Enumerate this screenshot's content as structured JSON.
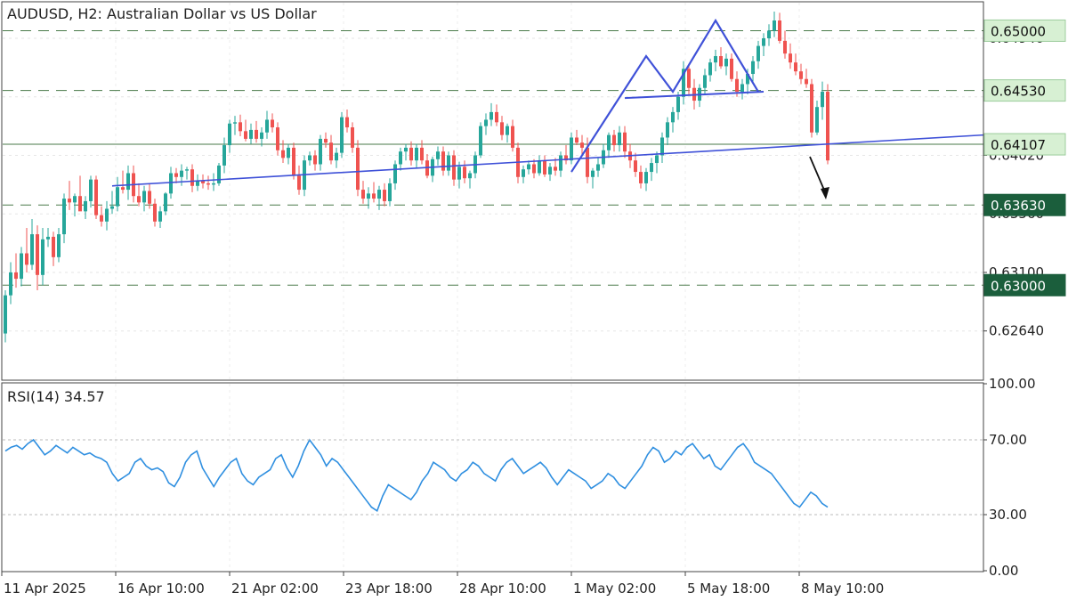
{
  "header": {
    "title": "AUDUSD, H2:  Australian Dollar vs US Dollar",
    "rsi_title": "RSI(14) 34.57"
  },
  "colors": {
    "bull": "#26a69a",
    "bear": "#ef5350",
    "trendline": "#3f51d8",
    "rsi": "#2f8fe0",
    "level_line": "#4a7a4a",
    "tag_light": "#d7f0d3",
    "tag_dark": "#1b5e3c"
  },
  "chart_data": [
    {
      "type": "candlestick",
      "title": "AUDUSD, H2:  Australian Dollar vs US Dollar",
      "ylim": [
        0.6226,
        0.6522
      ],
      "y_ticks": [
        "0.64940",
        "0.64480",
        "0.64020",
        "0.63560",
        "0.63100",
        "0.62640"
      ],
      "x_ticks": [
        "11 Apr 2025",
        "16 Apr 10:00",
        "21 Apr 02:00",
        "23 Apr 18:00",
        "28 Apr 10:00",
        "1 May 02:00",
        "5 May 18:00",
        "8 May 10:00"
      ],
      "levels": [
        {
          "value": 0.65,
          "label": "0.65000",
          "style": "dashed",
          "tag": "light"
        },
        {
          "value": 0.6453,
          "label": "0.64530",
          "style": "dashed",
          "tag": "light"
        },
        {
          "value": 0.64107,
          "label": "0.64107",
          "style": "solid",
          "tag": "light"
        },
        {
          "value": 0.6363,
          "label": "0.63630",
          "style": "dashed",
          "tag": "dark"
        },
        {
          "value": 0.63,
          "label": "0.63000",
          "style": "dashed",
          "tag": "dark"
        }
      ],
      "annotations": [
        {
          "type": "trendline",
          "description": "rising support line",
          "from": {
            "bar": 20,
            "price": 0.6378
          },
          "to": {
            "bar": 175,
            "price": 0.6416
          }
        },
        {
          "type": "neckline",
          "from": {
            "bar": 116,
            "price": 0.6447
          },
          "to": {
            "bar": 142,
            "price": 0.6452
          }
        },
        {
          "type": "pattern",
          "points": [
            {
              "bar": 106,
              "price": 0.6389
            },
            {
              "bar": 120,
              "price": 0.648
            },
            {
              "bar": 125,
              "price": 0.6452
            },
            {
              "bar": 133,
              "price": 0.6508
            },
            {
              "bar": 141,
              "price": 0.6452
            }
          ]
        },
        {
          "type": "arrow",
          "direction": "down"
        }
      ],
      "candles": [
        [
          0.6262,
          0.6296,
          0.6255,
          0.6292
        ],
        [
          0.6292,
          0.6318,
          0.6285,
          0.631
        ],
        [
          0.631,
          0.6325,
          0.6298,
          0.6305
        ],
        [
          0.6305,
          0.633,
          0.6299,
          0.6325
        ],
        [
          0.6325,
          0.6345,
          0.631,
          0.6316
        ],
        [
          0.6316,
          0.6352,
          0.6312,
          0.634
        ],
        [
          0.634,
          0.6347,
          0.6296,
          0.6308
        ],
        [
          0.6308,
          0.6345,
          0.63,
          0.6336
        ],
        [
          0.6336,
          0.6345,
          0.633,
          0.6338
        ],
        [
          0.6338,
          0.6342,
          0.6315,
          0.6322
        ],
        [
          0.6322,
          0.6345,
          0.6318,
          0.634
        ],
        [
          0.634,
          0.6372,
          0.6333,
          0.6368
        ],
        [
          0.6368,
          0.6382,
          0.6359,
          0.6365
        ],
        [
          0.6365,
          0.6372,
          0.6354,
          0.637
        ],
        [
          0.637,
          0.6386,
          0.6362,
          0.6358
        ],
        [
          0.6358,
          0.637,
          0.6352,
          0.6366
        ],
        [
          0.6366,
          0.6386,
          0.6361,
          0.6383
        ],
        [
          0.6383,
          0.6386,
          0.6352,
          0.6355
        ],
        [
          0.6355,
          0.6362,
          0.6346,
          0.635
        ],
        [
          0.635,
          0.6366,
          0.6343,
          0.636
        ],
        [
          0.636,
          0.6374,
          0.6356,
          0.6362
        ],
        [
          0.6362,
          0.6385,
          0.6358,
          0.6377
        ],
        [
          0.6377,
          0.639,
          0.6372,
          0.6375
        ],
        [
          0.6375,
          0.6394,
          0.6367,
          0.6388
        ],
        [
          0.6388,
          0.6394,
          0.6365,
          0.637
        ],
        [
          0.637,
          0.638,
          0.6362,
          0.6365
        ],
        [
          0.6365,
          0.6378,
          0.6358,
          0.6374
        ],
        [
          0.6374,
          0.638,
          0.636,
          0.6364
        ],
        [
          0.6364,
          0.6368,
          0.6346,
          0.635
        ],
        [
          0.635,
          0.6362,
          0.6345,
          0.6358
        ],
        [
          0.6358,
          0.6373,
          0.6355,
          0.6372
        ],
        [
          0.6372,
          0.6393,
          0.6368,
          0.6388
        ],
        [
          0.6388,
          0.6392,
          0.638,
          0.6385
        ],
        [
          0.6385,
          0.6395,
          0.6378,
          0.639
        ],
        [
          0.639,
          0.6393,
          0.6383,
          0.6391
        ],
        [
          0.6391,
          0.6395,
          0.6373,
          0.6378
        ],
        [
          0.6378,
          0.6387,
          0.6374,
          0.6382
        ],
        [
          0.6382,
          0.6387,
          0.6376,
          0.638
        ],
        [
          0.638,
          0.6386,
          0.6375,
          0.6379
        ],
        [
          0.6379,
          0.6388,
          0.6374,
          0.638
        ],
        [
          0.638,
          0.6396,
          0.6378,
          0.6394
        ],
        [
          0.6394,
          0.6416,
          0.6388,
          0.641
        ],
        [
          0.641,
          0.643,
          0.6404,
          0.6427
        ],
        [
          0.6427,
          0.6433,
          0.6418,
          0.6428
        ],
        [
          0.6428,
          0.6434,
          0.6417,
          0.6421
        ],
        [
          0.6421,
          0.643,
          0.6413,
          0.6415
        ],
        [
          0.6415,
          0.6427,
          0.6411,
          0.6422
        ],
        [
          0.6422,
          0.6429,
          0.6412,
          0.6415
        ],
        [
          0.6415,
          0.6424,
          0.6409,
          0.642
        ],
        [
          0.642,
          0.6437,
          0.6415,
          0.643
        ],
        [
          0.643,
          0.6435,
          0.642,
          0.6424
        ],
        [
          0.6424,
          0.6428,
          0.6402,
          0.6406
        ],
        [
          0.6406,
          0.6414,
          0.6396,
          0.64
        ],
        [
          0.64,
          0.6411,
          0.6395,
          0.6408
        ],
        [
          0.6408,
          0.6412,
          0.6383,
          0.6386
        ],
        [
          0.6386,
          0.6394,
          0.6371,
          0.6375
        ],
        [
          0.6375,
          0.6402,
          0.637,
          0.6398
        ],
        [
          0.6398,
          0.6405,
          0.6394,
          0.6402
        ],
        [
          0.6402,
          0.6406,
          0.639,
          0.6395
        ],
        [
          0.6395,
          0.6418,
          0.639,
          0.6415
        ],
        [
          0.6415,
          0.642,
          0.6408,
          0.6412
        ],
        [
          0.6412,
          0.6418,
          0.6395,
          0.6398
        ],
        [
          0.6398,
          0.6408,
          0.6392,
          0.6404
        ],
        [
          0.6404,
          0.6436,
          0.64,
          0.6432
        ],
        [
          0.6432,
          0.6438,
          0.642,
          0.6424
        ],
        [
          0.6424,
          0.6428,
          0.6404,
          0.6408
        ],
        [
          0.6408,
          0.6414,
          0.637,
          0.6375
        ],
        [
          0.6375,
          0.6382,
          0.6364,
          0.6368
        ],
        [
          0.6368,
          0.6377,
          0.636,
          0.6372
        ],
        [
          0.6372,
          0.6381,
          0.6365,
          0.6368
        ],
        [
          0.6368,
          0.6378,
          0.6359,
          0.6375
        ],
        [
          0.6375,
          0.638,
          0.6362,
          0.6366
        ],
        [
          0.6366,
          0.6384,
          0.6362,
          0.638
        ],
        [
          0.638,
          0.6398,
          0.6375,
          0.6395
        ],
        [
          0.6395,
          0.6408,
          0.639,
          0.6405
        ],
        [
          0.6405,
          0.6411,
          0.6398,
          0.6408
        ],
        [
          0.6408,
          0.6413,
          0.6394,
          0.6398
        ],
        [
          0.6398,
          0.6411,
          0.6392,
          0.6408
        ],
        [
          0.6408,
          0.6414,
          0.6395,
          0.6398
        ],
        [
          0.6398,
          0.6403,
          0.6384,
          0.6386
        ],
        [
          0.6386,
          0.6401,
          0.6381,
          0.6399
        ],
        [
          0.6399,
          0.6409,
          0.6394,
          0.6405
        ],
        [
          0.6405,
          0.6409,
          0.6386,
          0.639
        ],
        [
          0.639,
          0.6405,
          0.6386,
          0.6402
        ],
        [
          0.6402,
          0.6406,
          0.6378,
          0.6383
        ],
        [
          0.6383,
          0.6397,
          0.6376,
          0.6393
        ],
        [
          0.6393,
          0.6398,
          0.638,
          0.6384
        ],
        [
          0.6384,
          0.639,
          0.6376,
          0.6388
        ],
        [
          0.6388,
          0.6405,
          0.6384,
          0.6402
        ],
        [
          0.6402,
          0.6428,
          0.64,
          0.6425
        ],
        [
          0.6425,
          0.6435,
          0.6418,
          0.643
        ],
        [
          0.643,
          0.6443,
          0.6425,
          0.6436
        ],
        [
          0.6436,
          0.6442,
          0.6425,
          0.6428
        ],
        [
          0.6428,
          0.6433,
          0.6414,
          0.6418
        ],
        [
          0.6418,
          0.6427,
          0.6412,
          0.6425
        ],
        [
          0.6425,
          0.643,
          0.6405,
          0.6408
        ],
        [
          0.6408,
          0.6412,
          0.638,
          0.6385
        ],
        [
          0.6385,
          0.6394,
          0.638,
          0.6391
        ],
        [
          0.6391,
          0.6398,
          0.6387,
          0.6395
        ],
        [
          0.6395,
          0.6399,
          0.6384,
          0.6388
        ],
        [
          0.6388,
          0.6402,
          0.6386,
          0.6398
        ],
        [
          0.6398,
          0.6402,
          0.6385,
          0.6387
        ],
        [
          0.6387,
          0.6396,
          0.6382,
          0.6393
        ],
        [
          0.6393,
          0.64,
          0.6386,
          0.639
        ],
        [
          0.639,
          0.6405,
          0.6385,
          0.6402
        ],
        [
          0.6402,
          0.641,
          0.6395,
          0.6398
        ],
        [
          0.6398,
          0.642,
          0.6395,
          0.6416
        ],
        [
          0.6416,
          0.6422,
          0.641,
          0.6412
        ],
        [
          0.6412,
          0.6418,
          0.6402,
          0.6408
        ],
        [
          0.6408,
          0.6416,
          0.638,
          0.6385
        ],
        [
          0.6385,
          0.6392,
          0.6376,
          0.639
        ],
        [
          0.639,
          0.64,
          0.6385,
          0.6395
        ],
        [
          0.6395,
          0.6411,
          0.6392,
          0.6406
        ],
        [
          0.6406,
          0.642,
          0.64,
          0.6418
        ],
        [
          0.6418,
          0.6422,
          0.6405,
          0.641
        ],
        [
          0.641,
          0.6425,
          0.6405,
          0.642
        ],
        [
          0.642,
          0.6425,
          0.64,
          0.6405
        ],
        [
          0.6405,
          0.6411,
          0.6392,
          0.6398
        ],
        [
          0.6398,
          0.6404,
          0.6385,
          0.6389
        ],
        [
          0.6389,
          0.6394,
          0.6376,
          0.638
        ],
        [
          0.638,
          0.6392,
          0.6374,
          0.6389
        ],
        [
          0.6389,
          0.64,
          0.6382,
          0.6396
        ],
        [
          0.6396,
          0.6405,
          0.6388,
          0.6402
        ],
        [
          0.6402,
          0.642,
          0.6396,
          0.6416
        ],
        [
          0.6416,
          0.6432,
          0.641,
          0.6428
        ],
        [
          0.6428,
          0.644,
          0.642,
          0.6436
        ],
        [
          0.6436,
          0.6452,
          0.643,
          0.6448
        ],
        [
          0.6448,
          0.6476,
          0.6442,
          0.647
        ],
        [
          0.647,
          0.6473,
          0.645,
          0.6455
        ],
        [
          0.6455,
          0.6462,
          0.6438,
          0.6445
        ],
        [
          0.6445,
          0.6458,
          0.644,
          0.6455
        ],
        [
          0.6455,
          0.647,
          0.645,
          0.6465
        ],
        [
          0.6465,
          0.6478,
          0.646,
          0.6475
        ],
        [
          0.6475,
          0.6485,
          0.6468,
          0.648
        ],
        [
          0.648,
          0.6487,
          0.647,
          0.6472
        ],
        [
          0.6472,
          0.6482,
          0.6465,
          0.6478
        ],
        [
          0.6478,
          0.6482,
          0.646,
          0.6462
        ],
        [
          0.6462,
          0.6468,
          0.6448,
          0.6452
        ],
        [
          0.6452,
          0.6462,
          0.6446,
          0.6458
        ],
        [
          0.6458,
          0.647,
          0.645,
          0.6466
        ],
        [
          0.6466,
          0.648,
          0.646,
          0.6476
        ],
        [
          0.6476,
          0.6492,
          0.647,
          0.6488
        ],
        [
          0.6488,
          0.6498,
          0.648,
          0.6494
        ],
        [
          0.6494,
          0.6505,
          0.6488,
          0.65
        ],
        [
          0.65,
          0.6515,
          0.6495,
          0.6508
        ],
        [
          0.6508,
          0.6514,
          0.649,
          0.6492
        ],
        [
          0.6492,
          0.65,
          0.6478,
          0.6482
        ],
        [
          0.6482,
          0.649,
          0.647,
          0.6475
        ],
        [
          0.6475,
          0.6482,
          0.6465,
          0.6468
        ],
        [
          0.6468,
          0.6474,
          0.6458,
          0.6462
        ],
        [
          0.6462,
          0.647,
          0.6455,
          0.6458
        ],
        [
          0.6458,
          0.6462,
          0.6416,
          0.642
        ],
        [
          0.642,
          0.6445,
          0.6418,
          0.644
        ],
        [
          0.644,
          0.646,
          0.643,
          0.6452
        ],
        [
          0.6452,
          0.6458,
          0.6395,
          0.6398
        ]
      ]
    },
    {
      "type": "line",
      "title": "RSI(14) 34.57",
      "ylim": [
        0,
        100
      ],
      "y_ticks": [
        "100.00",
        "70.00",
        "30.00",
        "0.00"
      ],
      "levels": [
        70,
        30
      ],
      "series": [
        {
          "values": [
            64,
            66,
            67,
            65,
            68,
            70,
            66,
            62,
            64,
            67,
            65,
            63,
            66,
            64,
            62,
            63,
            61,
            60,
            58,
            52,
            48,
            50,
            52,
            58,
            60,
            56,
            54,
            55,
            53,
            47,
            45,
            50,
            58,
            62,
            64,
            55,
            50,
            45,
            50,
            54,
            58,
            60,
            52,
            48,
            46,
            50,
            52,
            54,
            60,
            62,
            55,
            50,
            56,
            64,
            70,
            66,
            62,
            56,
            60,
            58,
            54,
            50,
            46,
            42,
            38,
            34,
            32,
            40,
            46,
            44,
            42,
            40,
            38,
            42,
            48,
            52,
            58,
            56,
            54,
            50,
            48,
            52,
            54,
            58,
            56,
            52,
            50,
            48,
            54,
            58,
            60,
            56,
            52,
            54,
            56,
            58,
            55,
            50,
            46,
            50,
            54,
            52,
            50,
            48,
            44,
            46,
            48,
            52,
            50,
            46,
            44,
            48,
            52,
            56,
            62,
            66,
            64,
            58,
            60,
            64,
            62,
            66,
            68,
            64,
            60,
            62,
            56,
            54,
            58,
            62,
            66,
            68,
            64,
            58,
            56,
            54,
            52,
            48,
            44,
            40,
            36,
            34,
            38,
            42,
            40,
            36,
            34
          ]
        }
      ]
    }
  ]
}
